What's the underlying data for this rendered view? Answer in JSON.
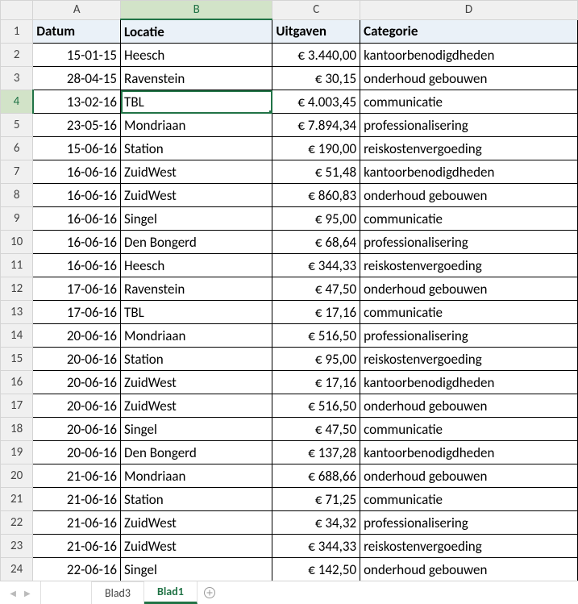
{
  "columns": [
    "A",
    "B",
    "C",
    "D"
  ],
  "selectedCol": "B",
  "selectedRow": 4,
  "header": {
    "A": "Datum",
    "B": "Locatie",
    "C": "Uitgaven",
    "D": "Categorie"
  },
  "rows": [
    {
      "n": 2,
      "A": "15-01-15",
      "B": "Heesch",
      "C": "€ 3.440,00",
      "D": "kantoorbenodigdheden"
    },
    {
      "n": 3,
      "A": "28-04-15",
      "B": "Ravenstein",
      "C": "€ 30,15",
      "D": "onderhoud gebouwen"
    },
    {
      "n": 4,
      "A": "13-02-16",
      "B": "TBL",
      "C": "€ 4.003,45",
      "D": "communicatie"
    },
    {
      "n": 5,
      "A": "23-05-16",
      "B": "Mondriaan",
      "C": "€ 7.894,34",
      "D": "professionalisering"
    },
    {
      "n": 6,
      "A": "15-06-16",
      "B": "Station",
      "C": "€ 190,00",
      "D": "reiskostenvergoeding"
    },
    {
      "n": 7,
      "A": "16-06-16",
      "B": "ZuidWest",
      "C": "€ 51,48",
      "D": "kantoorbenodigdheden"
    },
    {
      "n": 8,
      "A": "16-06-16",
      "B": "ZuidWest",
      "C": "€ 860,83",
      "D": "onderhoud gebouwen"
    },
    {
      "n": 9,
      "A": "16-06-16",
      "B": "Singel",
      "C": "€ 95,00",
      "D": "communicatie"
    },
    {
      "n": 10,
      "A": "16-06-16",
      "B": "Den Bongerd",
      "C": "€ 68,64",
      "D": "professionalisering"
    },
    {
      "n": 11,
      "A": "16-06-16",
      "B": "Heesch",
      "C": "€ 344,33",
      "D": "reiskostenvergoeding"
    },
    {
      "n": 12,
      "A": "17-06-16",
      "B": "Ravenstein",
      "C": "€ 47,50",
      "D": "onderhoud gebouwen"
    },
    {
      "n": 13,
      "A": "17-06-16",
      "B": "TBL",
      "C": "€ 17,16",
      "D": "communicatie"
    },
    {
      "n": 14,
      "A": "20-06-16",
      "B": "Mondriaan",
      "C": "€ 516,50",
      "D": "professionalisering"
    },
    {
      "n": 15,
      "A": "20-06-16",
      "B": "Station",
      "C": "€ 95,00",
      "D": "reiskostenvergoeding"
    },
    {
      "n": 16,
      "A": "20-06-16",
      "B": "ZuidWest",
      "C": "€ 17,16",
      "D": "kantoorbenodigdheden"
    },
    {
      "n": 17,
      "A": "20-06-16",
      "B": "ZuidWest",
      "C": "€ 516,50",
      "D": "onderhoud gebouwen"
    },
    {
      "n": 18,
      "A": "20-06-16",
      "B": "Singel",
      "C": "€ 47,50",
      "D": "communicatie"
    },
    {
      "n": 19,
      "A": "20-06-16",
      "B": "Den Bongerd",
      "C": "€ 137,28",
      "D": "kantoorbenodigdheden"
    },
    {
      "n": 20,
      "A": "21-06-16",
      "B": "Mondriaan",
      "C": "€ 688,66",
      "D": "onderhoud gebouwen"
    },
    {
      "n": 21,
      "A": "21-06-16",
      "B": "Station",
      "C": "€ 71,25",
      "D": "communicatie"
    },
    {
      "n": 22,
      "A": "21-06-16",
      "B": "ZuidWest",
      "C": "€ 34,32",
      "D": "professionalisering"
    },
    {
      "n": 23,
      "A": "21-06-16",
      "B": "ZuidWest",
      "C": "€ 344,33",
      "D": "reiskostenvergoeding"
    },
    {
      "n": 24,
      "A": "22-06-16",
      "B": "Singel",
      "C": "€ 142,50",
      "D": "onderhoud gebouwen"
    }
  ],
  "tabs": {
    "list": [
      {
        "name": "Blad3",
        "active": false
      },
      {
        "name": "Blad1",
        "active": true
      }
    ]
  }
}
